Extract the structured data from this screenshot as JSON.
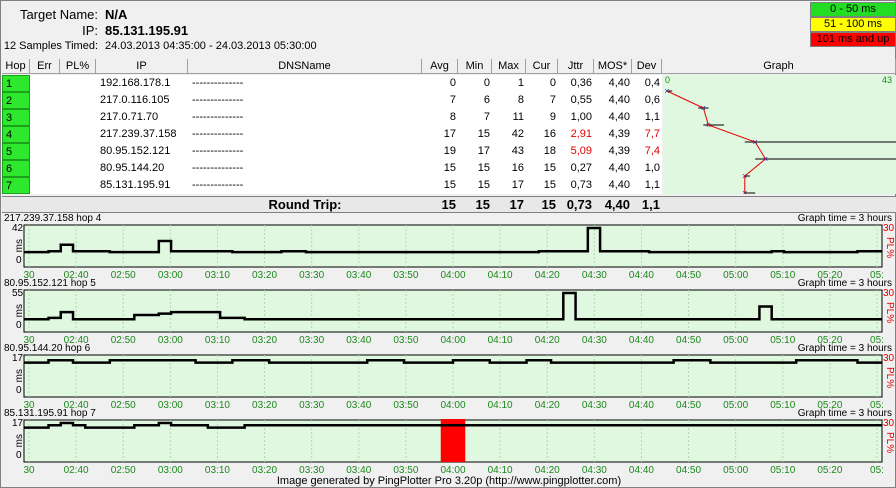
{
  "header": {
    "target_label": "Target Name:",
    "target_value": "N/A",
    "ip_label": "IP:",
    "ip_value": "85.131.195.91",
    "samples_label": "12 Samples Timed:",
    "samples_value": "24.03.2013 04:35:00 - 24.03.2013 05:30:00"
  },
  "legend": [
    {
      "label": "0 - 50 ms",
      "color": "#22dd22"
    },
    {
      "label": "51 - 100 ms",
      "color": "#ffff00"
    },
    {
      "label": "101 ms and up",
      "color": "#ff0000"
    }
  ],
  "table": {
    "columns": [
      "Hop",
      "Err",
      "PL%",
      "IP",
      "DNSName",
      "Avg",
      "Min",
      "Max",
      "Cur",
      "Jttr",
      "MOS*",
      "Dev",
      "Graph"
    ],
    "rows": [
      {
        "hop": "1",
        "err": "",
        "pl": "",
        "ip": "192.168.178.1",
        "dns": "--------------",
        "avg": "0",
        "min": "0",
        "max": "1",
        "cur": "0",
        "jttr": "0,36",
        "mos": "4,40",
        "dev": "0,4",
        "warn": false
      },
      {
        "hop": "2",
        "err": "",
        "pl": "",
        "ip": "217.0.116.105",
        "dns": "--------------",
        "avg": "7",
        "min": "6",
        "max": "8",
        "cur": "7",
        "jttr": "0,55",
        "mos": "4,40",
        "dev": "0,6",
        "warn": false
      },
      {
        "hop": "3",
        "err": "",
        "pl": "",
        "ip": "217.0.71.70",
        "dns": "--------------",
        "avg": "8",
        "min": "7",
        "max": "11",
        "cur": "9",
        "jttr": "1,00",
        "mos": "4,40",
        "dev": "1,1",
        "warn": false
      },
      {
        "hop": "4",
        "err": "",
        "pl": "",
        "ip": "217.239.37.158",
        "dns": "--------------",
        "avg": "17",
        "min": "15",
        "max": "42",
        "cur": "16",
        "jttr": "2,91",
        "mos": "4,39",
        "dev": "7,7",
        "warn": true
      },
      {
        "hop": "5",
        "err": "",
        "pl": "",
        "ip": "80.95.152.121",
        "dns": "--------------",
        "avg": "19",
        "min": "17",
        "max": "43",
        "cur": "18",
        "jttr": "5,09",
        "mos": "4,39",
        "dev": "7,4",
        "warn": true
      },
      {
        "hop": "6",
        "err": "",
        "pl": "",
        "ip": "80.95.144.20",
        "dns": "--------------",
        "avg": "15",
        "min": "15",
        "max": "16",
        "cur": "15",
        "jttr": "0,27",
        "mos": "4,40",
        "dev": "1,0",
        "warn": false
      },
      {
        "hop": "7",
        "err": "",
        "pl": "",
        "ip": "85.131.195.91",
        "dns": "--------------",
        "avg": "15",
        "min": "15",
        "max": "17",
        "cur": "15",
        "jttr": "0,73",
        "mos": "4,40",
        "dev": "1,1",
        "warn": false
      }
    ],
    "graph_scale_min": "0",
    "graph_scale_max": "43",
    "round_trip": {
      "label": "Round Trip:",
      "avg": "15",
      "min": "15",
      "max": "17",
      "cur": "15",
      "jttr": "0,73",
      "mos": "4,40",
      "dev": "1,1"
    }
  },
  "graphs": [
    {
      "title": "217.239.37.158 hop 4",
      "time": "Graph time = 3 hours",
      "ymax": "42",
      "ymin": "0",
      "pl_max": "30",
      "pl_label": "PL%",
      "ms_label": "ms",
      "values": [
        16,
        16,
        17,
        24,
        17,
        17,
        17,
        16,
        16,
        16,
        16,
        28,
        17,
        17,
        17,
        17,
        17,
        16,
        16,
        16,
        16,
        17,
        17,
        16,
        16,
        16,
        16,
        16,
        16,
        16,
        16,
        16,
        16,
        16,
        16,
        16,
        16,
        16,
        16,
        16,
        16,
        16,
        17,
        17,
        17,
        17,
        42,
        17,
        17,
        17,
        17,
        16,
        16,
        16,
        16,
        16,
        16,
        16,
        16,
        16,
        16,
        17,
        16,
        16,
        16,
        16,
        16,
        16,
        17,
        17
      ]
    },
    {
      "title": "80.95.152.121 hop 5",
      "time": "Graph time = 3 hours",
      "ymax": "55",
      "ymin": "0",
      "pl_max": "30",
      "pl_label": "PL%",
      "ms_label": "ms",
      "values": [
        18,
        18,
        20,
        28,
        18,
        18,
        18,
        18,
        18,
        24,
        24,
        26,
        28,
        28,
        28,
        28,
        20,
        20,
        18,
        18,
        18,
        18,
        18,
        18,
        18,
        18,
        18,
        18,
        18,
        18,
        18,
        18,
        18,
        18,
        18,
        18,
        18,
        18,
        18,
        18,
        18,
        18,
        18,
        18,
        55,
        18,
        18,
        18,
        18,
        18,
        18,
        18,
        18,
        18,
        18,
        18,
        18,
        18,
        18,
        18,
        36,
        18,
        18,
        18,
        18,
        18,
        18,
        18,
        18,
        18
      ]
    },
    {
      "title": "80.95.144.20 hop 6",
      "time": "Graph time = 3 hours",
      "ymax": "17",
      "ymin": "0",
      "pl_max": "30",
      "pl_label": "PL%",
      "ms_label": "ms",
      "values": [
        15,
        15,
        16,
        16,
        15,
        15,
        15,
        16,
        16,
        16,
        16,
        16,
        16,
        16,
        15,
        15,
        15,
        16,
        16,
        16,
        15,
        15,
        15,
        15,
        15,
        15,
        15,
        15,
        16,
        16,
        16,
        15,
        15,
        15,
        15,
        16,
        16,
        16,
        15,
        15,
        15,
        16,
        16,
        15,
        15,
        15,
        15,
        15,
        15,
        15,
        15,
        15,
        15,
        16,
        16,
        16,
        15,
        15,
        15,
        15,
        15,
        15,
        15,
        16,
        16,
        16,
        16,
        16,
        15,
        15
      ]
    },
    {
      "title": "85.131.195.91 hop 7",
      "time": "Graph time = 3 hours",
      "ymax": "17",
      "ymin": "0",
      "pl_max": "30",
      "pl_label": "PL%",
      "ms_label": "ms",
      "values": [
        15,
        15,
        16,
        17,
        16,
        15,
        15,
        15,
        15,
        16,
        16,
        17,
        16,
        16,
        16,
        15,
        15,
        15,
        16,
        16,
        16,
        16,
        16,
        16,
        16,
        16,
        16,
        16,
        16,
        16,
        16,
        16,
        16,
        16,
        16,
        16,
        16,
        16,
        16,
        16,
        16,
        16,
        16,
        16,
        16,
        16,
        16,
        16,
        16,
        16,
        16,
        16,
        16,
        16,
        16,
        16,
        16,
        16,
        16,
        16,
        16,
        16,
        16,
        16,
        16,
        16,
        16,
        16,
        16,
        16
      ],
      "loss_index": 34
    }
  ],
  "time_axis": [
    "30",
    "02:40",
    "02:50",
    "03:00",
    "03:10",
    "03:20",
    "03:30",
    "03:40",
    "03:50",
    "04:00",
    "04:10",
    "04:20",
    "04:30",
    "04:40",
    "04:50",
    "05:00",
    "05:10",
    "05:20",
    "05:"
  ],
  "footer": "Image generated by PingPlotter Pro 3.20p (http://www.pingplotter.com)"
}
